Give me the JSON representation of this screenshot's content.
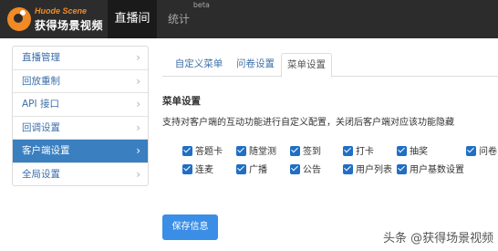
{
  "brand": {
    "name_en": "Huode Scene",
    "name_cn": "获得场景视频"
  },
  "nav": {
    "active": "直播间",
    "stats": "统计",
    "stats_badge": "beta"
  },
  "sidebar": {
    "items": [
      {
        "label": "直播管理",
        "active": false
      },
      {
        "label": "回放重制",
        "active": false
      },
      {
        "label": "API 接口",
        "active": false
      },
      {
        "label": "回调设置",
        "active": false
      },
      {
        "label": "客户端设置",
        "active": true
      },
      {
        "label": "全局设置",
        "active": false
      }
    ],
    "chevron": "›"
  },
  "tabs": [
    {
      "label": "自定义菜单",
      "active": false
    },
    {
      "label": "问卷设置",
      "active": false
    },
    {
      "label": "菜单设置",
      "active": true
    }
  ],
  "section": {
    "title": "菜单设置",
    "description": "支持对客户端的互动功能进行自定义配置，关闭后客户端对应该功能隐藏"
  },
  "options": [
    {
      "label": "答题卡",
      "checked": true
    },
    {
      "label": "随堂测",
      "checked": true
    },
    {
      "label": "签到",
      "checked": true
    },
    {
      "label": "打卡",
      "checked": true
    },
    {
      "label": "抽奖",
      "checked": true
    },
    {
      "label": "问卷",
      "checked": true
    },
    {
      "label": "连麦",
      "checked": true
    },
    {
      "label": "广播",
      "checked": true
    },
    {
      "label": "公告",
      "checked": true
    },
    {
      "label": "用户列表",
      "checked": true
    },
    {
      "label": "用户基数设置",
      "checked": true
    }
  ],
  "save_button": "保存信息",
  "watermark": "头条 @获得场景视频",
  "colors": {
    "topbar": "#2c2c2c",
    "accent": "#3a7fc0",
    "button": "#3a8ee6",
    "brand_orange": "#f08a24",
    "checkbox": "#1f6fc5"
  }
}
